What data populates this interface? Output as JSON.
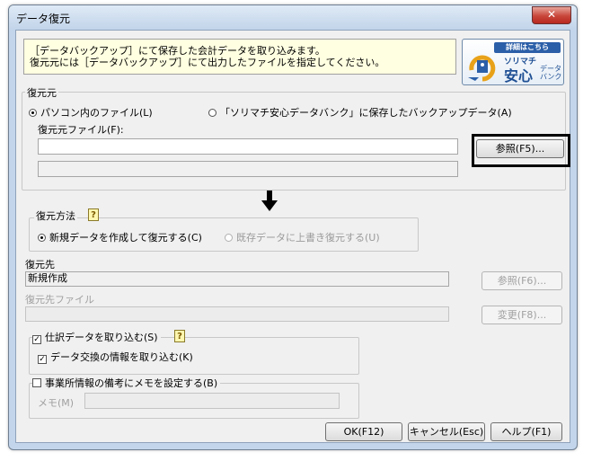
{
  "window": {
    "title": "データ復元",
    "close_glyph": "✕"
  },
  "info": {
    "line1": "［データバックアップ］にて保存した会計データを取り込みます。",
    "line2": "復元元には［データバックアップ］にて出力したファイルを指定してください。"
  },
  "logo": {
    "top": "詳細はこちら",
    "brand": "ソリマチ",
    "main": "安心",
    "side1": "データ",
    "side2": "バンク"
  },
  "source": {
    "legend": "復元元",
    "radio_local": "パソコン内のファイル(L)",
    "radio_bank": "「ソリマチ安心データバンク」に保存したバックアップデータ(A)",
    "file_label": "復元元ファイル(F):",
    "file_value": "",
    "browse_label": "参照(F5)..."
  },
  "method": {
    "legend": "復元方法",
    "radio_new": "新規データを作成して復元する(C)",
    "radio_overwrite": "既存データに上書き復元する(U)"
  },
  "dest": {
    "label": "復元先",
    "value": "新規作成",
    "browse_label": "参照(F6)...",
    "file_label": "復元先ファイル",
    "file_value": "",
    "change_label": "変更(F8)..."
  },
  "options": {
    "import_journal": "仕訳データを取り込む(S)",
    "import_exchange": "データ交換の情報を取り込む(K)",
    "memo_check": "事業所情報の備考にメモを設定する(B)",
    "memo_label": "メモ(M)",
    "memo_value": ""
  },
  "footer": {
    "ok": "OK(F12)",
    "cancel": "キャンセル(Esc)",
    "help": "ヘルプ(F1)"
  },
  "icons": {
    "help": "?",
    "check": "✓"
  }
}
